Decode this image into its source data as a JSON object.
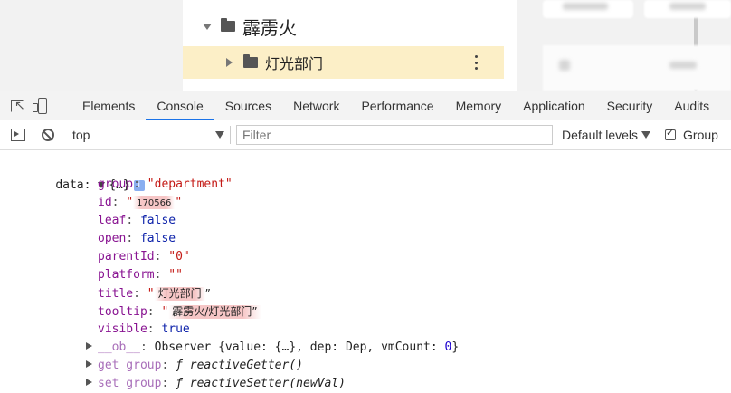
{
  "app": {
    "tree_root_label": "霹雳火",
    "tree_child_label": "灯光部门"
  },
  "devtools": {
    "tabs": [
      "Elements",
      "Console",
      "Sources",
      "Network",
      "Performance",
      "Memory",
      "Application",
      "Security",
      "Audits"
    ],
    "active_tab": "Console",
    "context_value": "top",
    "filter_placeholder": "Filter",
    "levels_label": "Default levels",
    "group_label": "Group"
  },
  "console": {
    "var_name": "data:",
    "object_preview": "{…}",
    "info_icon": "i",
    "props": [
      {
        "key": "group",
        "value": "\"department\"",
        "type": "string"
      },
      {
        "key": "id",
        "value": "170566",
        "type": "string"
      },
      {
        "key": "leaf",
        "value": "false",
        "type": "keyword"
      },
      {
        "key": "open",
        "value": "false",
        "type": "keyword"
      },
      {
        "key": "parentId",
        "value": "\"0\"",
        "type": "string"
      },
      {
        "key": "platform",
        "value": "\"\"",
        "type": "string"
      },
      {
        "key": "title",
        "value": "灯光部门",
        "type": "string"
      },
      {
        "key": "tooltip",
        "value": "霹雳火/灯光部门",
        "type": "string"
      },
      {
        "key": "visible",
        "value": "true",
        "type": "keyword"
      }
    ],
    "ob_line": {
      "key": "__ob__",
      "value": "Observer {value: {…}, dep: Dep, vmCount: ",
      "count": "0",
      "close": "}"
    },
    "getter_line": {
      "key": "get group",
      "value": "ƒ reactiveGetter()"
    },
    "setter_line": {
      "key": "set group",
      "value": "ƒ reactiveSetter(newVal)"
    }
  }
}
